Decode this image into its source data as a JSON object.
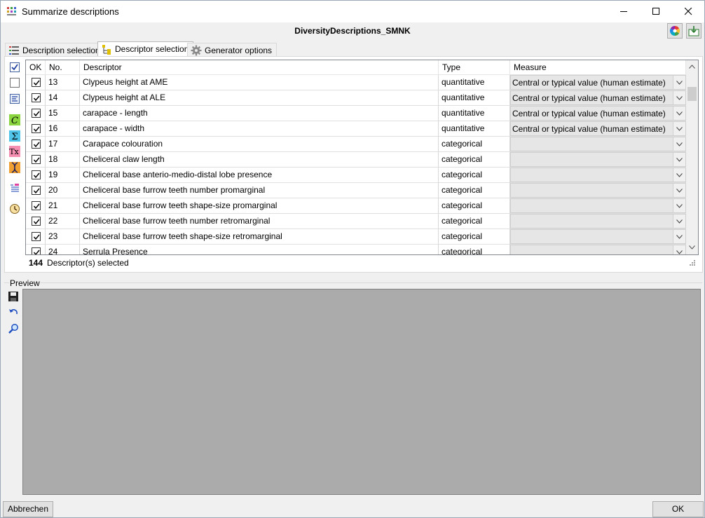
{
  "window": {
    "title": "Summarize descriptions",
    "minimize_icon": "minimize-icon",
    "maximize_icon": "maximize-icon",
    "close_icon": "close-icon"
  },
  "header": {
    "db_title": "DiversityDescriptions_SMNK",
    "buttons": [
      "color-wheel-icon",
      "export-icon"
    ]
  },
  "tabs": [
    {
      "label": "Description selection",
      "icon": "list-icon",
      "active": false
    },
    {
      "label": "Descriptor selection",
      "icon": "descriptor-tree-icon",
      "active": true
    },
    {
      "label": "Generator options",
      "icon": "gear-icon",
      "active": false
    }
  ],
  "left_toolbar": [
    "check-all-icon",
    "uncheck-all-icon",
    "filter-icon",
    "c-icon",
    "sigma-icon",
    "tx-icon",
    "dna-icon",
    "list-filter-icon",
    "clock-icon"
  ],
  "grid": {
    "columns": [
      "OK",
      "No.",
      "Descriptor",
      "Type",
      "Measure"
    ],
    "rows": [
      {
        "no": "13",
        "descriptor": "Clypeus height at AME",
        "type": "quantitative",
        "measure": "Central or typical value (human estimate)"
      },
      {
        "no": "14",
        "descriptor": "Clypeus height at ALE",
        "type": "quantitative",
        "measure": "Central or typical value (human estimate)"
      },
      {
        "no": "15",
        "descriptor": "carapace - length",
        "type": "quantitative",
        "measure": "Central or typical value (human estimate)"
      },
      {
        "no": "16",
        "descriptor": "carapace - width",
        "type": "quantitative",
        "measure": "Central or typical value (human estimate)"
      },
      {
        "no": "17",
        "descriptor": "Carapace colouration",
        "type": "categorical",
        "measure": ""
      },
      {
        "no": "18",
        "descriptor": "Cheliceral claw length",
        "type": "categorical",
        "measure": ""
      },
      {
        "no": "19",
        "descriptor": "Cheliceral base anterio-medio-distal lobe presence",
        "type": "categorical",
        "measure": ""
      },
      {
        "no": "20",
        "descriptor": "Cheliceral base furrow teeth number promarginal",
        "type": "categorical",
        "measure": ""
      },
      {
        "no": "21",
        "descriptor": "Cheliceral base furrow teeth shape-size promarginal",
        "type": "categorical",
        "measure": ""
      },
      {
        "no": "22",
        "descriptor": "Cheliceral base furrow teeth number retromarginal",
        "type": "categorical",
        "measure": ""
      },
      {
        "no": "23",
        "descriptor": "Cheliceral base furrow teeth shape-size retromarginal",
        "type": "categorical",
        "measure": ""
      },
      {
        "no": "24",
        "descriptor": "Serrula Presence",
        "type": "categorical",
        "measure": ""
      }
    ]
  },
  "status": {
    "count": "144",
    "label": "Descriptor(s) selected"
  },
  "preview": {
    "label": "Preview",
    "buttons": [
      "save-icon",
      "undo-icon",
      "zoom-icon"
    ]
  },
  "footer": {
    "cancel_label": "Abbrechen",
    "ok_label": "OK"
  }
}
